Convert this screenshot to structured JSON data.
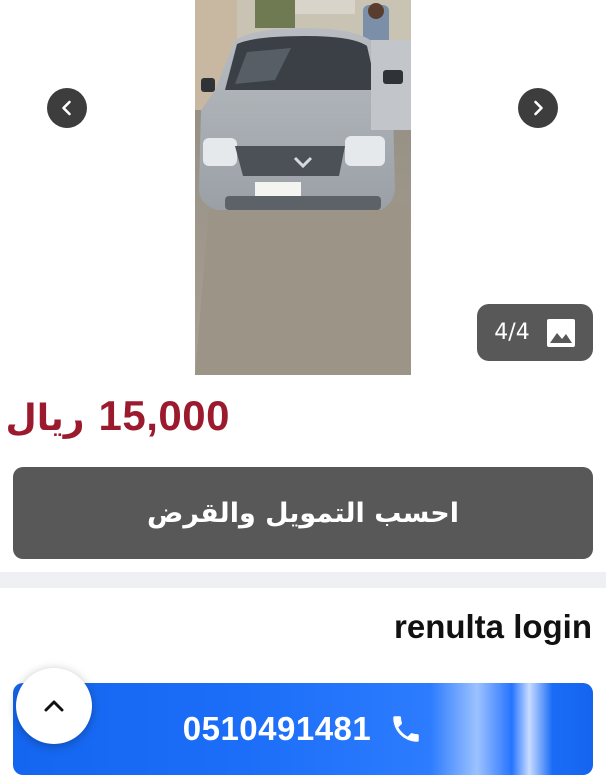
{
  "gallery": {
    "counter": "4/4",
    "prev_icon": "chevron-left-icon",
    "next_icon": "chevron-right-icon",
    "photo_icon": "image-icon"
  },
  "listing": {
    "price_amount": "15,000",
    "currency": "ريال",
    "finance_button": "احسب التمويل والقرض"
  },
  "seller": {
    "name": "renulta login",
    "phone": "0510491481",
    "phone_icon": "phone-icon"
  },
  "colors": {
    "price": "#9c1a2d",
    "finance_button_bg": "#585858",
    "call_button_bg": "#1a6cf6",
    "divider": "#eef0f4"
  }
}
